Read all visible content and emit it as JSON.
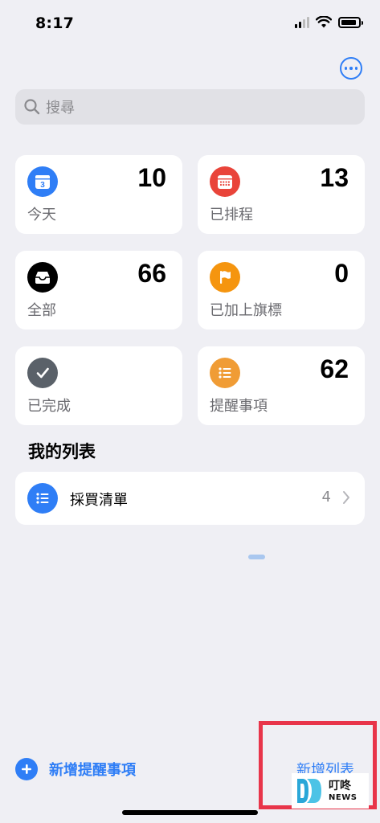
{
  "status_bar": {
    "time": "8:17",
    "battery_level": 0.9
  },
  "header": {
    "more_icon": "ellipsis-circle-icon"
  },
  "search": {
    "placeholder": "搜尋",
    "icon": "magnifier-icon"
  },
  "smart_lists": [
    {
      "label": "今天",
      "count": "10",
      "icon": "calendar-today-icon",
      "color": "#2f7ef6"
    },
    {
      "label": "已排程",
      "count": "13",
      "icon": "calendar-grid-icon",
      "color": "#e9443a"
    },
    {
      "label": "全部",
      "count": "66",
      "icon": "tray-icon",
      "color": "#000000"
    },
    {
      "label": "已加上旗標",
      "count": "0",
      "icon": "flag-icon",
      "color": "#f5950f"
    },
    {
      "label": "已完成",
      "count": "",
      "icon": "checkmark-icon",
      "color": "#5a6169"
    },
    {
      "label": "提醒事項",
      "count": "62",
      "icon": "list-bullet-icon",
      "color": "#f09c35"
    }
  ],
  "calendar_day": "3",
  "my_lists": {
    "title": "我的列表",
    "items": [
      {
        "name": "採買清單",
        "count": "4",
        "icon": "list-bullet-icon",
        "color": "#2f7ef6"
      }
    ]
  },
  "bottom_bar": {
    "new_reminder_label": "新增提醒事項",
    "add_list_label": "新增列表",
    "accent": "#2f7ef6"
  },
  "watermark": {
    "brand_cn": "叮咚",
    "brand_en": "NEWS"
  }
}
